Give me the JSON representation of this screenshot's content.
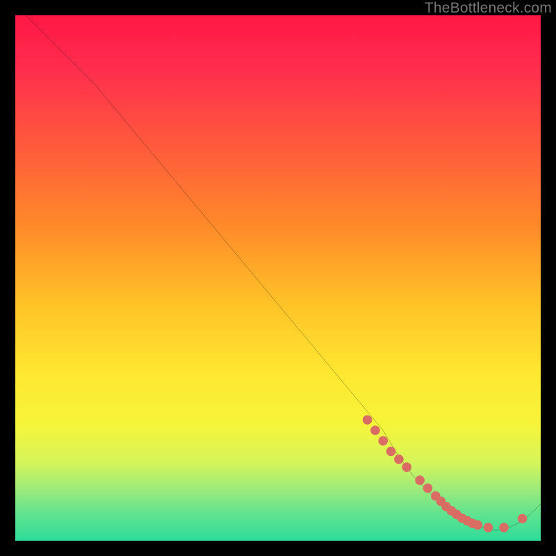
{
  "watermark": "TheBottleneck.com",
  "chart_data": {
    "type": "line",
    "title": "",
    "xlabel": "",
    "ylabel": "",
    "xlim": [
      0,
      100
    ],
    "ylim": [
      0,
      100
    ],
    "grid": false,
    "legend": false,
    "series": [
      {
        "name": "curve",
        "x": [
          2,
          6,
          10,
          15,
          20,
          25,
          30,
          35,
          40,
          45,
          50,
          55,
          60,
          65,
          70,
          73,
          76,
          79,
          82,
          85,
          88,
          90,
          92,
          94,
          96,
          98,
          100
        ],
        "y": [
          100,
          96,
          92,
          87,
          81,
          75,
          69,
          63,
          57,
          51,
          45,
          39,
          33,
          27,
          21,
          16,
          12,
          9,
          6,
          4,
          3,
          2,
          2,
          2.5,
          3.5,
          5,
          7
        ]
      }
    ],
    "scatter_highlight": {
      "name": "points",
      "color": "#d96d63",
      "radius": 6,
      "x": [
        67,
        68.5,
        70,
        71.5,
        73,
        74.5,
        77,
        78.5,
        80,
        81,
        82,
        83,
        84,
        85,
        86,
        87,
        88,
        90,
        93,
        96.5
      ],
      "y": [
        23,
        21,
        19,
        17,
        15.5,
        14,
        11.5,
        10,
        8.5,
        7.5,
        6.5,
        5.7,
        5,
        4.3,
        3.8,
        3.3,
        3,
        2.5,
        2.5,
        4.2
      ]
    },
    "colors": {
      "line": "#000000",
      "background_top": "#ff1744",
      "background_bottom": "#2fdc9a"
    }
  }
}
